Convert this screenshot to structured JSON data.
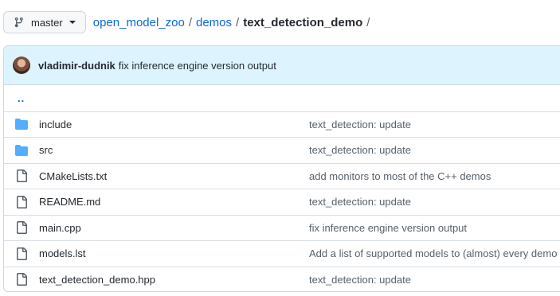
{
  "branch": {
    "label": "master",
    "icon": "git-branch-icon"
  },
  "breadcrumb": {
    "items": [
      "open_model_zoo",
      "demos"
    ],
    "current": "text_detection_demo",
    "trailing_sep": "/"
  },
  "commit": {
    "author": "vladimir-dudnik",
    "message": "fix inference engine version output"
  },
  "parent_link": "..",
  "files": [
    {
      "type": "folder",
      "icon": "folder-icon",
      "name": "include",
      "message": "text_detection: update"
    },
    {
      "type": "folder",
      "icon": "folder-icon",
      "name": "src",
      "message": "text_detection: update"
    },
    {
      "type": "file",
      "icon": "file-icon",
      "name": "CMakeLists.txt",
      "message": "add monitors to most of the C++ demos"
    },
    {
      "type": "file",
      "icon": "file-icon",
      "name": "README.md",
      "message": "text_detection: update"
    },
    {
      "type": "file",
      "icon": "file-icon",
      "name": "main.cpp",
      "message": "fix inference engine version output"
    },
    {
      "type": "file",
      "icon": "file-icon",
      "name": "models.lst",
      "message": "Add a list of supported models to (almost) every demo"
    },
    {
      "type": "file",
      "icon": "file-icon",
      "name": "text_detection_demo.hpp",
      "message": "text_detection: update"
    }
  ],
  "colors": {
    "link": "#0969da",
    "folder": "#54aeff",
    "commit_bg": "#ddf4ff"
  }
}
